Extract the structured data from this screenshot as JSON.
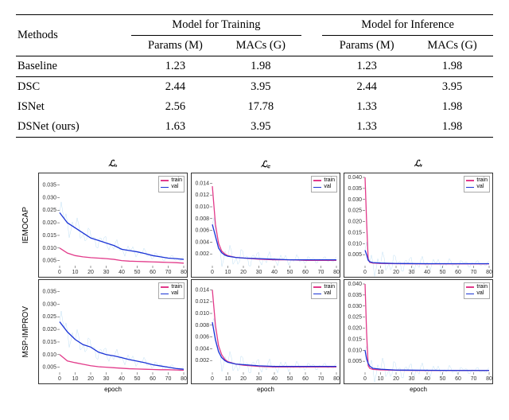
{
  "table": {
    "columns": {
      "methods": "Methods",
      "group_train": "Model for Training",
      "group_infer": "Model for Inference",
      "params": "Params (M)",
      "macs": "MACs (G)"
    },
    "rows": [
      {
        "method": "Baseline",
        "t_params": "1.23",
        "t_macs": "1.98",
        "i_params": "1.23",
        "i_macs": "1.98"
      },
      {
        "method": "DSC",
        "t_params": "2.44",
        "t_macs": "3.95",
        "i_params": "2.44",
        "i_macs": "3.95"
      },
      {
        "method": "ISNet",
        "t_params": "2.56",
        "t_macs": "17.78",
        "i_params": "1.33",
        "i_macs": "1.98"
      },
      {
        "method": "DSNet (ours)",
        "t_params": "1.63",
        "t_macs": "3.95",
        "i_params": "1.33",
        "i_macs": "1.98"
      }
    ]
  },
  "charts": {
    "col_titles": [
      "ℒₒ",
      "ℒ꜀",
      "ℒᵣ"
    ],
    "row_labels": [
      "IEMOCAP",
      "MSP-IMPROV"
    ],
    "xlabel": "epoch",
    "legend": {
      "train": "train",
      "val": "val"
    },
    "colors": {
      "train": "#e23a8a",
      "val": "#1a33d6",
      "noise": "#a7d3f0"
    },
    "x_ticks": [
      0,
      10,
      20,
      30,
      40,
      50,
      60,
      70,
      80
    ],
    "panels": {
      "Lo": {
        "y_ticks": [
          0.005,
          0.01,
          0.015,
          0.02,
          0.025,
          0.03,
          0.035
        ],
        "ylim": [
          0.003,
          0.038
        ]
      },
      "Lc": {
        "y_ticks": [
          0.002,
          0.004,
          0.006,
          0.008,
          0.01,
          0.012,
          0.014
        ],
        "ylim": [
          0.0,
          0.015
        ]
      },
      "Lr": {
        "y_ticks": [
          0.005,
          0.01,
          0.015,
          0.02,
          0.025,
          0.03,
          0.035,
          0.04
        ],
        "ylim": [
          0.0,
          0.04
        ]
      }
    }
  },
  "chart_data": [
    {
      "type": "line",
      "title": "Lo IEMOCAP",
      "xlabel": "epoch",
      "ylabel": "",
      "xlim": [
        0,
        80
      ],
      "ylim": [
        0.003,
        0.038
      ],
      "x": [
        0,
        5,
        10,
        15,
        20,
        25,
        30,
        35,
        40,
        45,
        50,
        55,
        60,
        65,
        70,
        75,
        80
      ],
      "series": [
        {
          "name": "train",
          "values": [
            0.01,
            0.008,
            0.007,
            0.0065,
            0.0062,
            0.006,
            0.0058,
            0.0055,
            0.005,
            0.0048,
            0.0047,
            0.0046,
            0.0045,
            0.0044,
            0.0043,
            0.0042,
            0.004
          ]
        },
        {
          "name": "val",
          "values": [
            0.024,
            0.02,
            0.018,
            0.016,
            0.014,
            0.013,
            0.012,
            0.011,
            0.0095,
            0.009,
            0.0085,
            0.0078,
            0.007,
            0.0065,
            0.006,
            0.0058,
            0.0055
          ]
        }
      ]
    },
    {
      "type": "line",
      "title": "Lc IEMOCAP",
      "xlabel": "epoch",
      "ylabel": "",
      "xlim": [
        0,
        80
      ],
      "ylim": [
        0.0,
        0.015
      ],
      "x": [
        0,
        2,
        4,
        6,
        8,
        10,
        15,
        20,
        30,
        40,
        50,
        60,
        70,
        80
      ],
      "series": [
        {
          "name": "train",
          "values": [
            0.0135,
            0.007,
            0.0038,
            0.0025,
            0.002,
            0.0017,
            0.0014,
            0.0013,
            0.0011,
            0.001,
            0.001,
            0.0009,
            0.0009,
            0.0009
          ]
        },
        {
          "name": "val",
          "values": [
            0.007,
            0.005,
            0.003,
            0.0022,
            0.0018,
            0.0016,
            0.0014,
            0.0013,
            0.0012,
            0.0011,
            0.001,
            0.001,
            0.001,
            0.001
          ]
        }
      ]
    },
    {
      "type": "line",
      "title": "Lr IEMOCAP",
      "xlabel": "epoch",
      "ylabel": "",
      "xlim": [
        0,
        80
      ],
      "ylim": [
        0.0,
        0.04
      ],
      "x": [
        0,
        1,
        2,
        3,
        5,
        10,
        20,
        40,
        60,
        80
      ],
      "series": [
        {
          "name": "train",
          "values": [
            0.06,
            0.02,
            0.003,
            0.0015,
            0.0012,
            0.001,
            0.0009,
            0.0008,
            0.0008,
            0.0008
          ]
        },
        {
          "name": "val",
          "values": [
            0.007,
            0.005,
            0.0025,
            0.0018,
            0.0014,
            0.0012,
            0.001,
            0.0009,
            0.0009,
            0.0009
          ]
        }
      ]
    },
    {
      "type": "line",
      "title": "Lo MSP-IMPROV",
      "xlabel": "epoch",
      "ylabel": "",
      "xlim": [
        0,
        80
      ],
      "ylim": [
        0.003,
        0.038
      ],
      "x": [
        0,
        5,
        10,
        15,
        20,
        25,
        30,
        35,
        40,
        45,
        50,
        55,
        60,
        65,
        70,
        75,
        80
      ],
      "series": [
        {
          "name": "train",
          "values": [
            0.01,
            0.0075,
            0.0068,
            0.0062,
            0.0056,
            0.0052,
            0.005,
            0.0048,
            0.0046,
            0.0044,
            0.0043,
            0.0042,
            0.0041,
            0.004,
            0.004,
            0.0039,
            0.0038
          ]
        },
        {
          "name": "val",
          "values": [
            0.023,
            0.019,
            0.016,
            0.014,
            0.013,
            0.011,
            0.01,
            0.0095,
            0.0088,
            0.008,
            0.0074,
            0.0068,
            0.006,
            0.0055,
            0.005,
            0.0045,
            0.0042
          ]
        }
      ]
    },
    {
      "type": "line",
      "title": "Lc MSP-IMPROV",
      "xlabel": "epoch",
      "ylabel": "",
      "xlim": [
        0,
        80
      ],
      "ylim": [
        0.0,
        0.015
      ],
      "x": [
        0,
        2,
        4,
        6,
        8,
        10,
        15,
        20,
        30,
        40,
        50,
        60,
        70,
        80
      ],
      "series": [
        {
          "name": "train",
          "values": [
            0.014,
            0.008,
            0.0045,
            0.003,
            0.0022,
            0.0018,
            0.0014,
            0.0012,
            0.001,
            0.0009,
            0.0009,
            0.0009,
            0.0009,
            0.0009
          ]
        },
        {
          "name": "val",
          "values": [
            0.0085,
            0.0055,
            0.0035,
            0.0025,
            0.002,
            0.0017,
            0.0014,
            0.0013,
            0.0011,
            0.001,
            0.001,
            0.001,
            0.001,
            0.001
          ]
        }
      ]
    },
    {
      "type": "line",
      "title": "Lr MSP-IMPROV",
      "xlabel": "epoch",
      "ylabel": "",
      "xlim": [
        0,
        80
      ],
      "ylim": [
        0.0,
        0.04
      ],
      "x": [
        0,
        1,
        2,
        3,
        5,
        10,
        20,
        40,
        60,
        80
      ],
      "series": [
        {
          "name": "train",
          "values": [
            0.055,
            0.018,
            0.003,
            0.0018,
            0.0013,
            0.0011,
            0.0009,
            0.0008,
            0.0008,
            0.0008
          ]
        },
        {
          "name": "val",
          "values": [
            0.01,
            0.006,
            0.004,
            0.0028,
            0.0018,
            0.0014,
            0.001,
            0.0009,
            0.0008,
            0.0008
          ]
        }
      ]
    }
  ]
}
